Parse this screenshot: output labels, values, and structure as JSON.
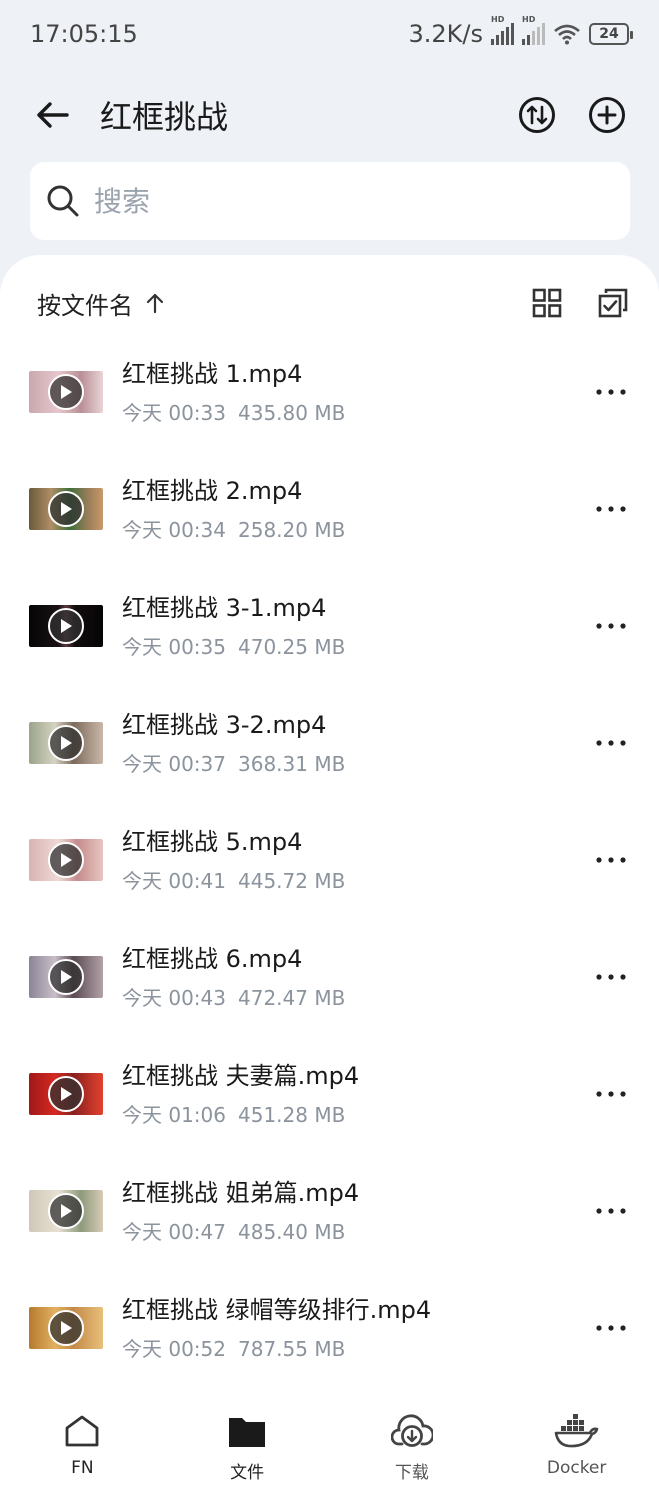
{
  "status_bar": {
    "time": "17:05:15",
    "net_speed": "3.2K/s",
    "signal_tag": "HD",
    "battery": "24"
  },
  "header": {
    "title": "红框挑战"
  },
  "search": {
    "placeholder": "搜索"
  },
  "sort": {
    "label": "按文件名"
  },
  "files": [
    {
      "name": "红框挑战 1.mp4",
      "time": "今天 00:33",
      "size": "435.80 MB"
    },
    {
      "name": "红框挑战 2.mp4",
      "time": "今天 00:34",
      "size": "258.20 MB"
    },
    {
      "name": "红框挑战 3-1.mp4",
      "time": "今天 00:35",
      "size": "470.25 MB"
    },
    {
      "name": "红框挑战 3-2.mp4",
      "time": "今天 00:37",
      "size": "368.31 MB"
    },
    {
      "name": "红框挑战 5.mp4",
      "time": "今天 00:41",
      "size": "445.72 MB"
    },
    {
      "name": "红框挑战 6.mp4",
      "time": "今天 00:43",
      "size": "472.47 MB"
    },
    {
      "name": "红框挑战 夫妻篇.mp4",
      "time": "今天 01:06",
      "size": "451.28 MB"
    },
    {
      "name": "红框挑战 姐弟篇.mp4",
      "time": "今天 00:47",
      "size": "485.40 MB"
    },
    {
      "name": "红框挑战 绿帽等级排行.mp4",
      "time": "今天 00:52",
      "size": "787.55 MB"
    }
  ],
  "nav": [
    {
      "label": "FN",
      "icon": "home-icon"
    },
    {
      "label": "文件",
      "icon": "folder-icon"
    },
    {
      "label": "下载",
      "icon": "cloud-download-icon"
    },
    {
      "label": "Docker",
      "icon": "docker-icon"
    }
  ]
}
